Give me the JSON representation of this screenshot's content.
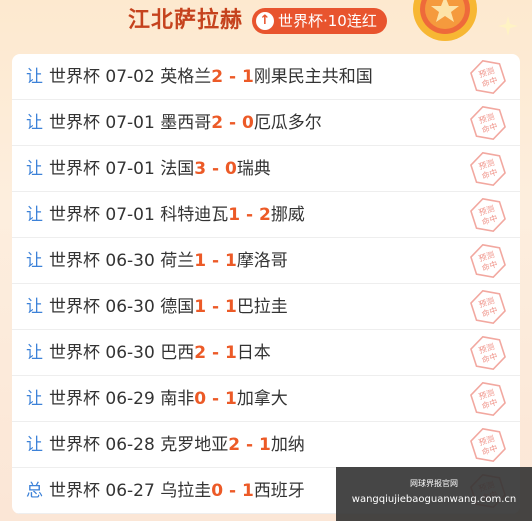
{
  "header": {
    "expert_name": "江北萨拉赫",
    "streak_text": "世界杯·10连红"
  },
  "matches": [
    {
      "tag": "让",
      "league": "世界杯",
      "date": "07-02",
      "home": "英格兰",
      "home_score": "2",
      "sep": " - ",
      "away_score": "1",
      "away": "刚果民主共和国",
      "stamp": "预测命中"
    },
    {
      "tag": "让",
      "league": "世界杯",
      "date": "07-01",
      "home": "墨西哥",
      "home_score": "2",
      "sep": " - ",
      "away_score": "0",
      "away": "厄瓜多尔",
      "stamp": "预测命中"
    },
    {
      "tag": "让",
      "league": "世界杯",
      "date": "07-01",
      "home": "法国",
      "home_score": "3",
      "sep": " - ",
      "away_score": "0",
      "away": "瑞典",
      "stamp": "预测命中"
    },
    {
      "tag": "让",
      "league": "世界杯",
      "date": "07-01",
      "home": "科特迪瓦",
      "home_score": "1",
      "sep": " - ",
      "away_score": "2",
      "away": "挪威",
      "stamp": "预测命中"
    },
    {
      "tag": "让",
      "league": "世界杯",
      "date": "06-30",
      "home": "荷兰",
      "home_score": "1",
      "sep": " - ",
      "away_score": "1",
      "away": "摩洛哥",
      "stamp": "预测命中"
    },
    {
      "tag": "让",
      "league": "世界杯",
      "date": "06-30",
      "home": "德国",
      "home_score": "1",
      "sep": " - ",
      "away_score": "1",
      "away": "巴拉圭",
      "stamp": "预测命中"
    },
    {
      "tag": "让",
      "league": "世界杯",
      "date": "06-30",
      "home": "巴西",
      "home_score": "2",
      "sep": " - ",
      "away_score": "1",
      "away": "日本",
      "stamp": "预测命中"
    },
    {
      "tag": "让",
      "league": "世界杯",
      "date": "06-29",
      "home": "南非",
      "home_score": "0",
      "sep": " - ",
      "away_score": "1",
      "away": "加拿大",
      "stamp": "预测命中"
    },
    {
      "tag": "让",
      "league": "世界杯",
      "date": "06-28",
      "home": "克罗地亚",
      "home_score": "2",
      "sep": " - ",
      "away_score": "1",
      "away": "加纳",
      "stamp": "预测命中"
    },
    {
      "tag": "总",
      "league": "世界杯",
      "date": "06-27",
      "home": "乌拉圭",
      "home_score": "0",
      "sep": " - ",
      "away_score": "1",
      "away": "西班牙",
      "stamp": "预测命中"
    }
  ],
  "watermark": {
    "title": "网球界报官网",
    "url": "wangqiujiebaoguanwang.com.cn"
  },
  "colors": {
    "accent": "#e8542e",
    "score": "#ec5a27",
    "tag": "#3d82d8",
    "title": "#c5421d"
  }
}
